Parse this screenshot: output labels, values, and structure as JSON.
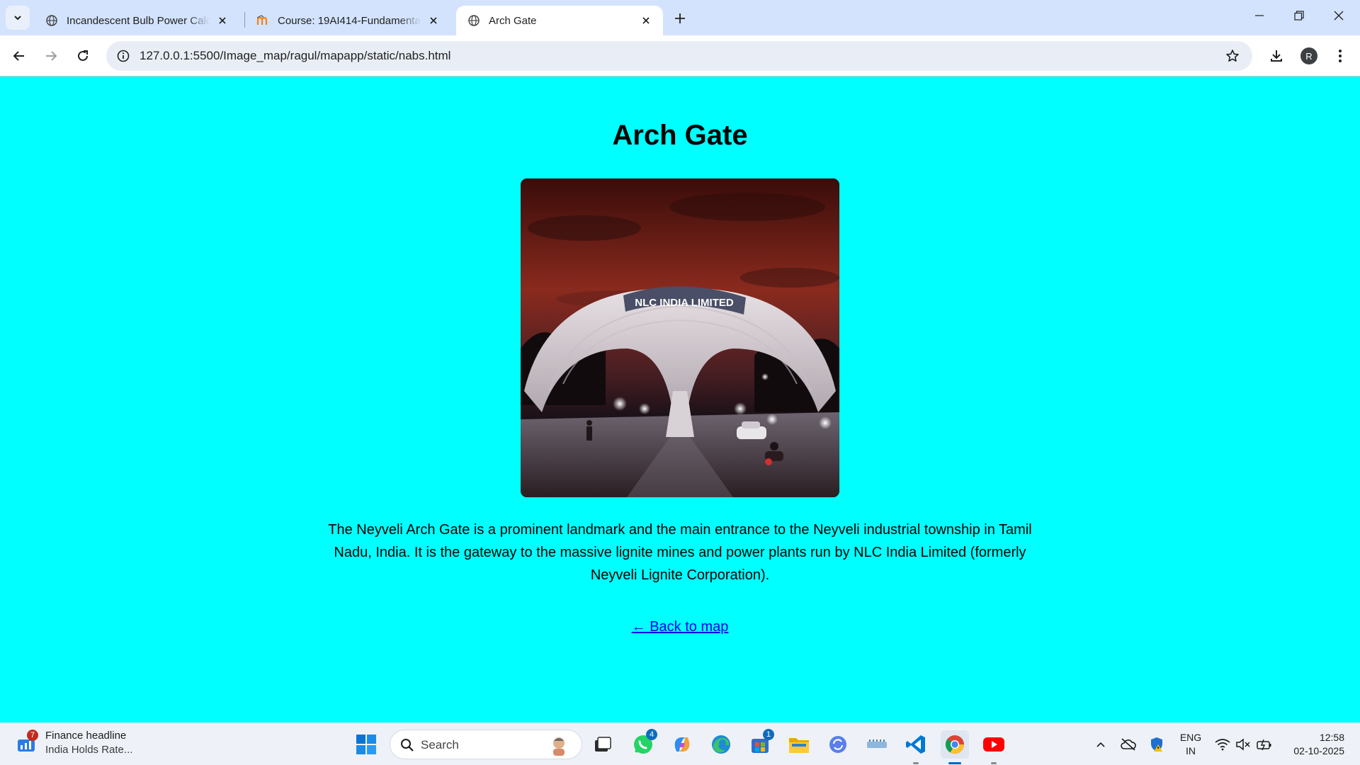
{
  "browser": {
    "tabs": [
      {
        "title": "Incandescent Bulb Power Calcul",
        "active": false,
        "favicon": "globe-icon"
      },
      {
        "title": "Course: 19AI414-Fundamentals",
        "active": false,
        "favicon": "moodle-icon"
      },
      {
        "title": "Arch Gate",
        "active": true,
        "favicon": "globe-icon"
      }
    ],
    "url": "127.0.0.1:5500/Image_map/ragul/mapapp/static/nabs.html",
    "profile_initial": "R"
  },
  "page": {
    "title": "Arch Gate",
    "image_alt": "NLC India Limited arch gate at night",
    "image_sign_text": "NLC INDIA LIMITED",
    "description": "The Neyveli Arch Gate is a prominent landmark and the main entrance to the Neyveli industrial township in Tamil Nadu, India. It is the gateway to the massive lignite mines and power plants run by NLC India Limited (formerly Neyveli Lignite Corporation).",
    "back_link": "← Back to map",
    "background_color": "#00ffff"
  },
  "taskbar": {
    "widget": {
      "badge": "7",
      "headline": "Finance headline",
      "subtext": "India Holds Rate..."
    },
    "search_label": "Search",
    "whatsapp_badge": "4",
    "store_badge": "1",
    "language": {
      "line1": "ENG",
      "line2": "IN"
    },
    "clock": {
      "time": "12:58",
      "date": "02-10-2025"
    }
  }
}
